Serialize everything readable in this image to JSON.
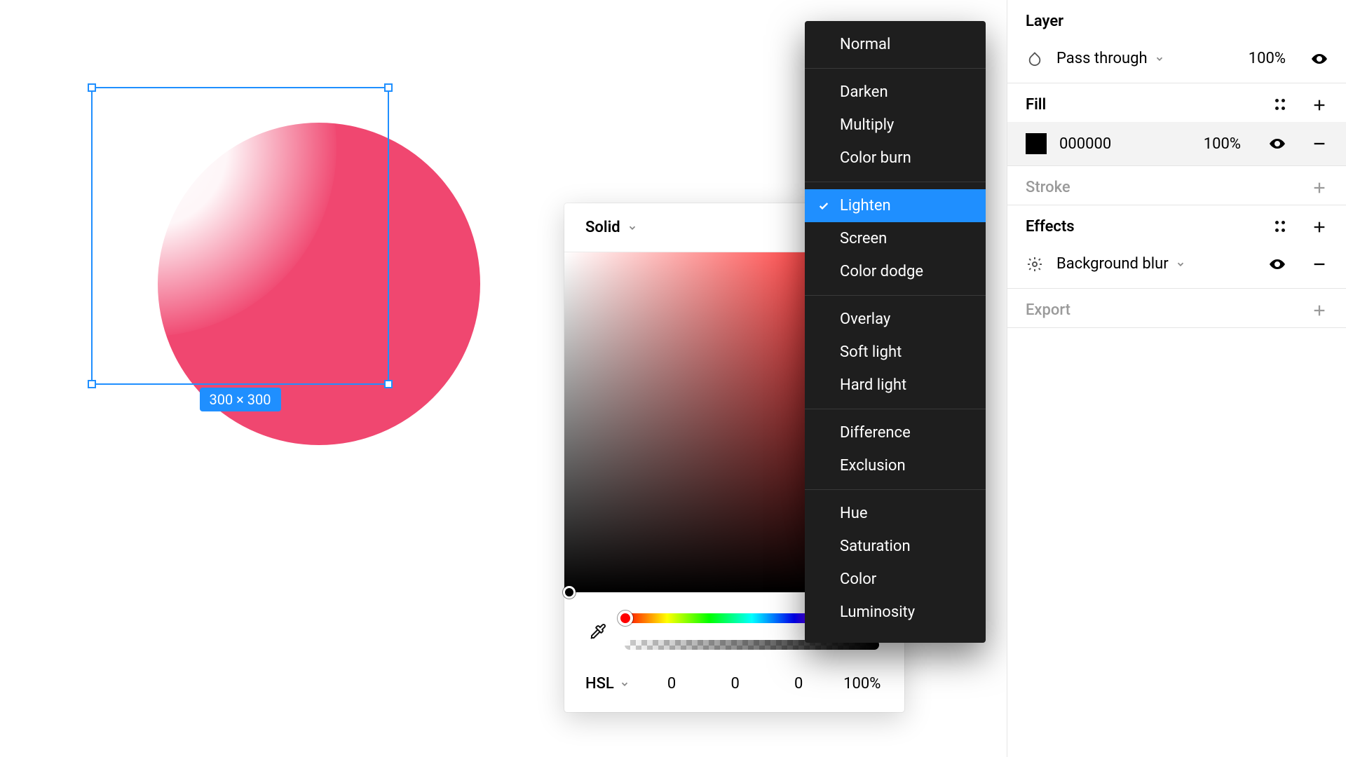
{
  "selection": {
    "size_label": "300 × 300"
  },
  "picker": {
    "mode_label": "Solid",
    "value_mode": "HSL",
    "h": "0",
    "s": "0",
    "l": "0",
    "a": "100%"
  },
  "blend_modes": {
    "groups": [
      [
        "Normal"
      ],
      [
        "Darken",
        "Multiply",
        "Color burn"
      ],
      [
        "Lighten",
        "Screen",
        "Color dodge"
      ],
      [
        "Overlay",
        "Soft light",
        "Hard light"
      ],
      [
        "Difference",
        "Exclusion"
      ],
      [
        "Hue",
        "Saturation",
        "Color",
        "Luminosity"
      ]
    ],
    "selected": "Lighten"
  },
  "inspector": {
    "layer": {
      "title": "Layer",
      "mode": "Pass through",
      "opacity": "100%"
    },
    "fill": {
      "title": "Fill",
      "hex": "000000",
      "opacity": "100%"
    },
    "stroke": {
      "title": "Stroke"
    },
    "effects": {
      "title": "Effects",
      "item": "Background blur"
    },
    "export": {
      "title": "Export"
    }
  }
}
